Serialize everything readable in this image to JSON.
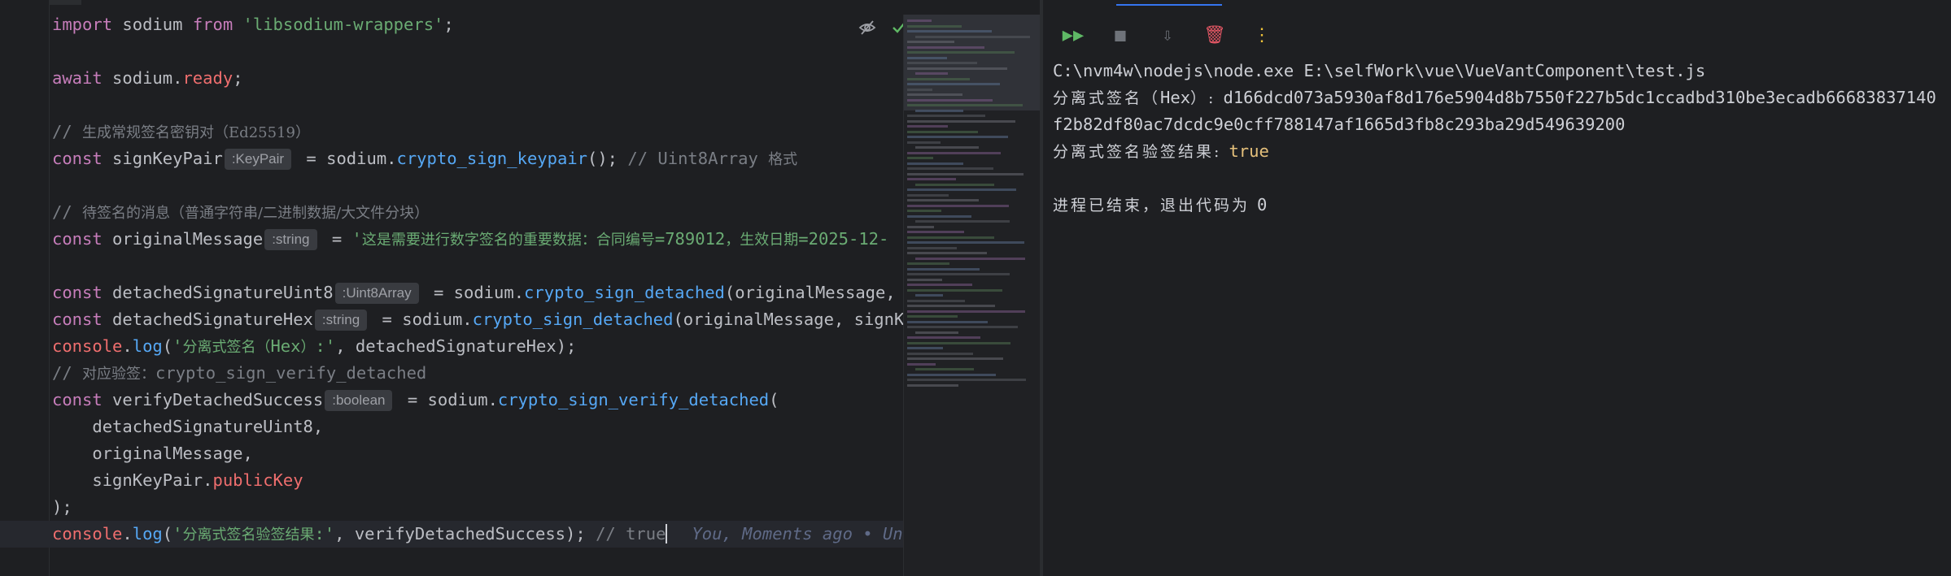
{
  "editor": {
    "lines": [
      [
        {
          "c": "kw2",
          "t": "import"
        },
        {
          "t": " sodium "
        },
        {
          "c": "kw2",
          "t": "from"
        },
        {
          "t": " "
        },
        {
          "c": "str",
          "t": "'libsodium-wrappers'"
        },
        {
          "t": ";"
        }
      ],
      [],
      [
        {
          "c": "kw2",
          "t": "await"
        },
        {
          "t": " sodium."
        },
        {
          "c": "propR",
          "t": "ready"
        },
        {
          "t": ";"
        }
      ],
      [],
      [
        {
          "c": "cmt",
          "t": "// "
        },
        {
          "c": "cmtzh",
          "t": "生成常规签名密钥对（Ed25519）"
        }
      ],
      [
        {
          "c": "kw2",
          "t": "const"
        },
        {
          "t": " signKeyPair"
        },
        {
          "c": "hint",
          "t": ":KeyPair"
        },
        {
          "t": " = sodium."
        },
        {
          "c": "fn",
          "t": "crypto_sign_keypair"
        },
        {
          "t": "(); "
        },
        {
          "c": "cmt",
          "t": "// Uint8Array "
        },
        {
          "c": "cmtzh",
          "t": "格式"
        }
      ],
      [],
      [
        {
          "c": "cmt",
          "t": "// "
        },
        {
          "c": "cmtzh",
          "t": "待签名的消息（普通字符串/二进制数据/大文件分块）"
        }
      ],
      [
        {
          "c": "kw2",
          "t": "const"
        },
        {
          "t": " originalMessage"
        },
        {
          "c": "hint",
          "t": ":string"
        },
        {
          "t": " = "
        },
        {
          "c": "str",
          "t": "'"
        },
        {
          "c": "str zh",
          "t": "这是需要进行数字签名的重要数据：合同编号"
        },
        {
          "c": "str",
          "t": "=789012"
        },
        {
          "c": "str zh",
          "t": "，生效日期"
        },
        {
          "c": "str",
          "t": "=2025-12-"
        }
      ],
      [],
      [
        {
          "c": "kw2",
          "t": "const"
        },
        {
          "t": " detachedSignatureUint8"
        },
        {
          "c": "hint",
          "t": ":Uint8Array"
        },
        {
          "t": " = sodium."
        },
        {
          "c": "fn",
          "t": "crypto_sign_detached"
        },
        {
          "t": "(originalMessage, s"
        }
      ],
      [
        {
          "c": "kw2",
          "t": "const"
        },
        {
          "t": " detachedSignatureHex"
        },
        {
          "c": "hint",
          "t": ":string"
        },
        {
          "t": " = sodium."
        },
        {
          "c": "fn",
          "t": "crypto_sign_detached"
        },
        {
          "t": "(originalMessage, signKey"
        }
      ],
      [
        {
          "c": "propR",
          "t": "console"
        },
        {
          "t": "."
        },
        {
          "c": "fn",
          "t": "log"
        },
        {
          "t": "("
        },
        {
          "c": "str",
          "t": "'"
        },
        {
          "c": "str zh",
          "t": "分离式签名（"
        },
        {
          "c": "str",
          "t": "Hex"
        },
        {
          "c": "str zh",
          "t": "）"
        },
        {
          "c": "str",
          "t": ":'"
        },
        {
          "t": ", detachedSignatureHex);"
        }
      ],
      [
        {
          "c": "cmt",
          "t": "// "
        },
        {
          "c": "cmtzh",
          "t": "对应验签："
        },
        {
          "c": "cmt",
          "t": "crypto_sign_verify_detached"
        }
      ],
      [
        {
          "c": "kw2",
          "t": "const"
        },
        {
          "t": " verifyDetachedSuccess"
        },
        {
          "c": "hint",
          "t": ":boolean"
        },
        {
          "t": " = sodium."
        },
        {
          "c": "fn",
          "t": "crypto_sign_verify_detached"
        },
        {
          "t": "("
        }
      ],
      [
        {
          "t": "    detachedSignatureUint8,"
        }
      ],
      [
        {
          "t": "    originalMessage,"
        }
      ],
      [
        {
          "t": "    signKeyPair."
        },
        {
          "c": "propR",
          "t": "publicKey"
        }
      ],
      [
        {
          "t": ");"
        }
      ],
      [
        {
          "c": "propR",
          "t": "console"
        },
        {
          "t": "."
        },
        {
          "c": "fn",
          "t": "log"
        },
        {
          "t": "("
        },
        {
          "c": "str",
          "t": "'"
        },
        {
          "c": "str zh",
          "t": "分离式签名验签结果"
        },
        {
          "c": "str",
          "t": ":'"
        },
        {
          "t": ", verifyDetachedSuccess); "
        },
        {
          "c": "cmt",
          "t": "// true"
        },
        {
          "c": "caret",
          "t": ""
        },
        {
          "c": "blame",
          "t": "You, Moments ago • Unco"
        }
      ]
    ]
  },
  "lens_icons": [
    "eye-off-icon",
    "checkmark-icon"
  ],
  "colors": {
    "accent": "#3574f0",
    "run_green": "#5fb865",
    "stop_gray": "#6f737a",
    "delete_red": "#e55765",
    "more_yellow": "#f0c43a"
  },
  "run": {
    "toolbar": [
      {
        "name": "rerun-icon",
        "glyph": "▶▶",
        "color": "#5fb865"
      },
      {
        "name": "stop-icon",
        "glyph": "■",
        "color": "#6f737a"
      },
      {
        "name": "scroll-to-end-icon",
        "glyph": "⇩",
        "color": "#6f737a"
      },
      {
        "name": "clear-all-icon",
        "glyph": "🗑",
        "color": "#e55765"
      },
      {
        "name": "more-options-icon",
        "glyph": "⋮",
        "color": "#f0c43a"
      }
    ],
    "output": [
      {
        "parts": [
          {
            "t": "C:\\nvm4w\\nodejs\\node.exe E:\\selfWork\\vue\\VueVantComponent\\test.js"
          }
        ]
      },
      {
        "parts": [
          {
            "c": "zhc",
            "t": "分离式签名（"
          },
          {
            "t": "Hex"
          },
          {
            "c": "zhc",
            "t": "）: "
          },
          {
            "t": "d166dcd073a5930af8d176e5904d8b7550f227b5dc1ccadbd310be3ecadb66683837140"
          }
        ]
      },
      {
        "parts": [
          {
            "t": "f2b82df80ac7dcdc9e0cff788147af1665d3fb8c293ba29d549639200"
          }
        ]
      },
      {
        "parts": [
          {
            "c": "zhc",
            "t": "分离式签名验签结果: "
          },
          {
            "c": "truec",
            "t": "true"
          }
        ]
      },
      {
        "parts": []
      },
      {
        "parts": [
          {
            "c": "zhc",
            "t": "进程已结束，退出代码为 "
          },
          {
            "t": "0"
          }
        ]
      }
    ]
  }
}
